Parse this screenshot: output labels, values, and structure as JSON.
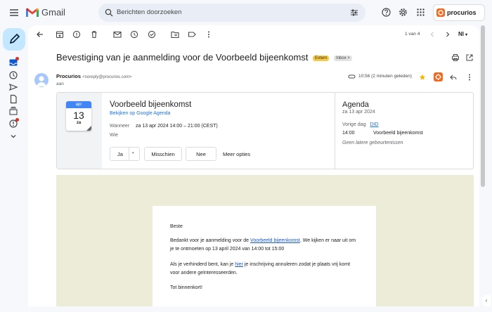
{
  "app": {
    "name": "Gmail"
  },
  "search": {
    "placeholder": "Berichten doorzoeken"
  },
  "account": {
    "brand": "procurios"
  },
  "toolbar": {
    "pager": "1 van 4",
    "lang": "Nl"
  },
  "message": {
    "subject": "Bevestiging van je aanmelding voor de Voorbeeld bijeenkomst",
    "labels": [
      "Extern",
      "Inbox ×"
    ],
    "sender_name": "Procurios",
    "sender_email": "<noreply@procurios.com>",
    "to": "aan",
    "time": "10:56 (2 minuten geleden)"
  },
  "invite": {
    "month": "apr",
    "day": "13",
    "weekday": "za",
    "title": "Voorbeeld bijeenkomst",
    "calendar_link": "Bekijken op Google Agenda",
    "when_label": "Wanneer",
    "when_value": "za 13 apr 2024 14:00 – 21:00 (CEST)",
    "who_label": "Wie",
    "rsvp_yes": "Ja",
    "rsvp_maybe": "Misschien",
    "rsvp_no": "Nee",
    "more_options": "Meer opties"
  },
  "agenda": {
    "title": "Agenda",
    "date": "za 13 apr 2024",
    "prev_day_label": "Vorige dag",
    "prev_day_link": "DID",
    "event_time": "14:00",
    "event_title": "Voorbeeld bijeenkomst",
    "no_more": "Geen latere gebeurtenissen"
  },
  "body": {
    "greeting": "Beste",
    "p1_before": "Bedankt voor je aanmelding voor de ",
    "p1_link": "Voorbeeld bijeenkomst",
    "p1_after": ". We kijken er naar uit om je te ontmoeten op 13 april 2024 van 14:00 tot 15:00",
    "p2_before": "Als je verhinderd bent, kan je ",
    "p2_link": "hier",
    "p2_after": " je inschrijving annuleren zodat je plaats vrij komt voor andere geïnteresseerden.",
    "closing": "Tot binnenkort!"
  }
}
